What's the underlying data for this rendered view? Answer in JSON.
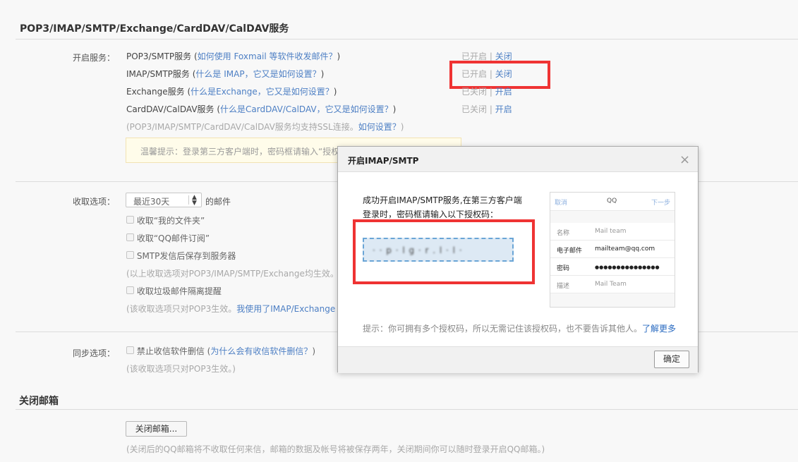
{
  "section1": {
    "title": "POP3/IMAP/SMTP/Exchange/CardDAV/CalDAV服务",
    "open_label": "开启服务：",
    "services": [
      {
        "name": "POP3/SMTP服务 (",
        "help": "如何使用 Foxmail 等软件收发邮件？",
        "close_paren": ")",
        "status": "已开启",
        "sep": "|",
        "action": "关闭"
      },
      {
        "name": "IMAP/SMTP服务 (",
        "help": "什么是 IMAP，它又是如何设置？",
        "close_paren": ")",
        "status": "已开启",
        "sep": "|",
        "action": "关闭"
      },
      {
        "name": "Exchange服务 (",
        "help": "什么是Exchange，它又是如何设置？",
        "close_paren": ")",
        "status": "已关闭",
        "sep": "|",
        "action": "开启"
      },
      {
        "name": "CardDAV/CalDAV服务 (",
        "help": "什么是CardDAV/CalDAV，它又是如何设置？",
        "close_paren": ")",
        "status": "已关闭",
        "sep": "|",
        "action": "开启"
      }
    ],
    "ssl_note": "(POP3/IMAP/SMTP/CardDAV/CalDAV服务均支持SSL连接。",
    "ssl_link": "如何设置？",
    "ssl_close": ")",
    "tip": "温馨提示：登录第三方客户端时，密码框请输入“授权"
  },
  "receive": {
    "label": "收取选项：",
    "select_value": "最近30天",
    "select_suffix": "的邮件",
    "options": [
      "收取“我的文件夹”",
      "收取“QQ邮件订阅”",
      "SMTP发信后保存到服务器"
    ],
    "note1": "(以上收取选项对POP3/IMAP/SMTP/Exchange均生效。",
    "spam_option": "收取垃圾邮件隔离提醒",
    "note2_pre": "(该收取选项只对POP3生效。",
    "note2_link": "我使用了IMAP/Exchange"
  },
  "sync": {
    "label": "同步选项：",
    "option": "禁止收信软件删信",
    "help_open": "(",
    "help": "为什么会有收信软件删信？",
    "help_close": ")",
    "note": "(该收取选项只对POP3生效。)"
  },
  "close_mailbox": {
    "title": "关闭邮箱",
    "button": "关闭邮箱...",
    "note": "(关闭后的QQ邮箱将不收取任何来信，邮箱的数据及帐号将被保存两年，关闭期间你可以随时登录开启QQ邮箱。)"
  },
  "modal": {
    "title": "开启IMAP/SMTP",
    "close_glyph": "×",
    "line1": "成功开启IMAP/SMTP服务,在第三方客户端",
    "line2": "登录时，密码框请输入以下授权码：",
    "auth_code_blurred": "·    ·  p  ·  l  g  ·  r  .  l  ·  l  ·",
    "phone": {
      "cancel": "取消",
      "title": "QQ",
      "next": "下一步",
      "rows": [
        {
          "key": "名称",
          "value": "Mail team"
        },
        {
          "key": "电子邮件",
          "value": "mailteam@qq.com"
        },
        {
          "key": "密码",
          "value": "●●●●●●●●●●●●●●●"
        },
        {
          "key": "描述",
          "value": "Mail Team"
        }
      ]
    },
    "hint": "提示：你可拥有多个授权码，所以无需记住该授权码，也不要告诉其他人。",
    "hint_link": "了解更多",
    "ok": "确定"
  }
}
